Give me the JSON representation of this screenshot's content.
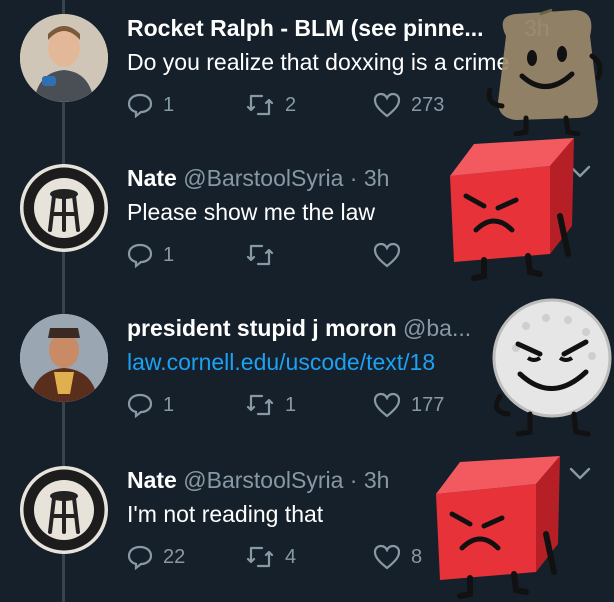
{
  "tweets": [
    {
      "name": "Rocket Ralph - BLM (see pinne...",
      "handle": "",
      "separator": "",
      "time": "3h",
      "text": "Do you realize that doxxing is a crime",
      "replies": "1",
      "retweets": "2",
      "likes": "273",
      "avatar_icon": "person-photo-icon"
    },
    {
      "name": "Nate",
      "handle": "@BarstoolSyria",
      "separator": "·",
      "time": "3h",
      "text": "Please show me the law",
      "replies": "1",
      "retweets": "",
      "likes": "",
      "avatar_icon": "barstool-logo-icon"
    },
    {
      "name": "president stupid j moron",
      "handle": "@ba...",
      "separator": "",
      "time": "",
      "text": "law.cornell.edu/uscode/text/18",
      "replies": "1",
      "retweets": "1",
      "likes": "177",
      "avatar_icon": "person-photo-icon"
    },
    {
      "name": "Nate",
      "handle": "@BarstoolSyria",
      "separator": "·",
      "time": "3h",
      "text": "I'm not reading that",
      "replies": "22",
      "retweets": "4",
      "likes": "8",
      "avatar_icon": "barstool-logo-icon"
    }
  ],
  "colors": {
    "background": "#15202b",
    "secondary_text": "#8899a6",
    "link": "#1da1f2",
    "character_red": "#e8323a"
  }
}
